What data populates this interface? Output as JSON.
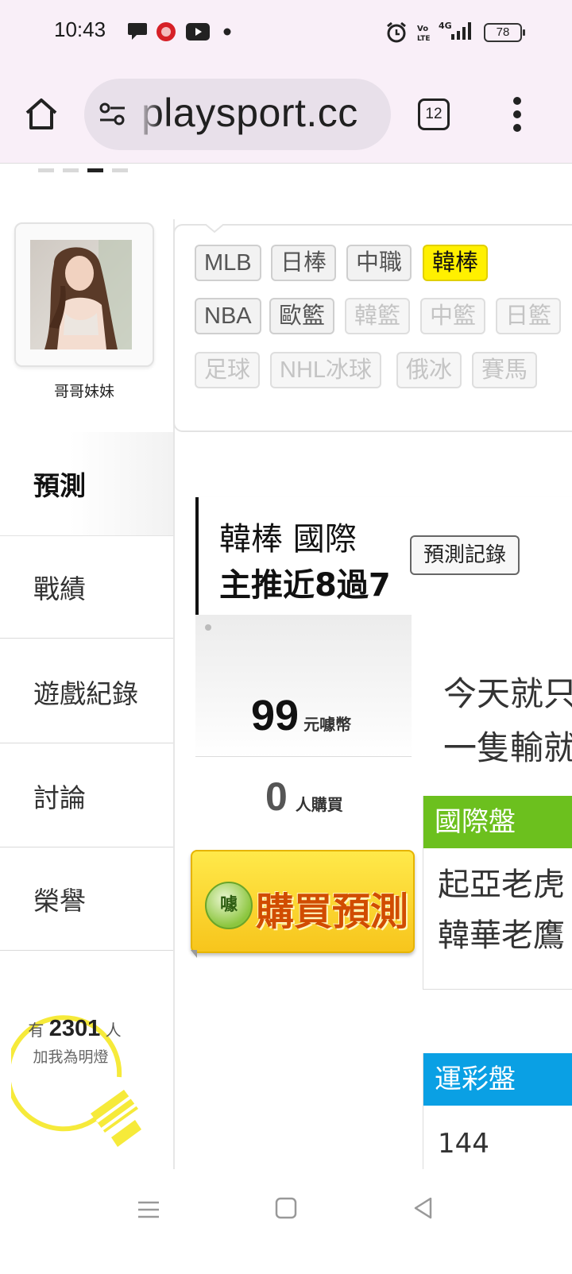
{
  "status_bar": {
    "time": "10:43",
    "battery": "78",
    "icons": [
      "chat-icon",
      "app-badge-icon",
      "youtube-icon",
      "dot-icon",
      "alarm-icon",
      "volte-icon",
      "signal-4g-icon",
      "battery-icon"
    ]
  },
  "browser": {
    "url": "playsport.cc",
    "tab_count": "12",
    "icons": [
      "home-icon",
      "site-settings-icon",
      "tabs-icon",
      "more-vert-icon"
    ]
  },
  "profile": {
    "name": "哥哥妹妹"
  },
  "nav": {
    "items": [
      {
        "label": "預測",
        "active": true
      },
      {
        "label": "戰績",
        "active": false
      },
      {
        "label": "遊戲紀錄",
        "active": false
      },
      {
        "label": "討論",
        "active": false
      },
      {
        "label": "榮譽",
        "active": false
      }
    ]
  },
  "fans": {
    "prefix": "有",
    "count": "2301",
    "suffix": "人",
    "caption": "加我為明燈"
  },
  "sport_tags": {
    "row1": [
      {
        "label": "MLB",
        "state": "normal"
      },
      {
        "label": "日棒",
        "state": "normal"
      },
      {
        "label": "中職",
        "state": "normal"
      },
      {
        "label": "韓棒",
        "state": "selected"
      }
    ],
    "row2": [
      {
        "label": "NBA",
        "state": "normal"
      },
      {
        "label": "歐籃",
        "state": "normal"
      },
      {
        "label": "韓籃",
        "state": "disabled"
      },
      {
        "label": "中籃",
        "state": "disabled"
      },
      {
        "label": "日籃",
        "state": "disabled"
      }
    ],
    "row3": [
      {
        "label": "足球",
        "state": "disabled"
      },
      {
        "label": "NHL冰球",
        "state": "disabled"
      },
      {
        "label": "俄冰",
        "state": "disabled"
      },
      {
        "label": "賽馬",
        "state": "disabled"
      }
    ]
  },
  "prediction": {
    "league_line": "韓棒 國際",
    "record_line": "主推近8過7",
    "record_button": "預測記錄",
    "price": "99",
    "price_unit": "元噱幣",
    "buyers": "0",
    "buyers_unit": "人購買",
    "buy_button": "購買預測",
    "buy_coin_text": "噱",
    "description_lines": [
      "今天就只",
      "一隻輸就"
    ]
  },
  "odds": [
    {
      "title": "國際盤",
      "color": "#6cc01e",
      "lines": [
        "起亞老虎",
        "韓華老鷹"
      ]
    },
    {
      "title": "運彩盤",
      "color": "#0aa0e4",
      "lines": [
        "144"
      ]
    }
  ],
  "system_nav": {
    "icons": [
      "recents-icon",
      "home-square-icon",
      "back-icon"
    ]
  }
}
